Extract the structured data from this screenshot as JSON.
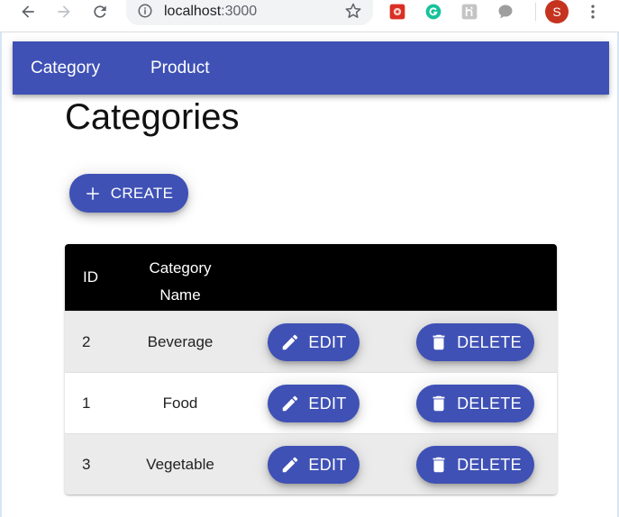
{
  "browser": {
    "url_host": "localhost",
    "url_port": ":3000",
    "profile_initial": "S",
    "icons": [
      "back-icon",
      "forward-icon",
      "reload-icon",
      "info-icon",
      "star-icon",
      "extension-icon",
      "grammarly-icon",
      "extension-icon",
      "chat-icon",
      "more-icon"
    ]
  },
  "appbar": {
    "color": "#3f51b5",
    "links": [
      "Category",
      "Product"
    ]
  },
  "page": {
    "title": "Categories",
    "create_label": "CREATE"
  },
  "table": {
    "headers": {
      "id": "ID",
      "name_line1": "Category",
      "name_line2": "Name"
    },
    "edit_label": "EDIT",
    "delete_label": "DELETE",
    "rows": [
      {
        "id": "2",
        "name": "Beverage"
      },
      {
        "id": "1",
        "name": "Food"
      },
      {
        "id": "3",
        "name": "Vegetable"
      }
    ]
  }
}
